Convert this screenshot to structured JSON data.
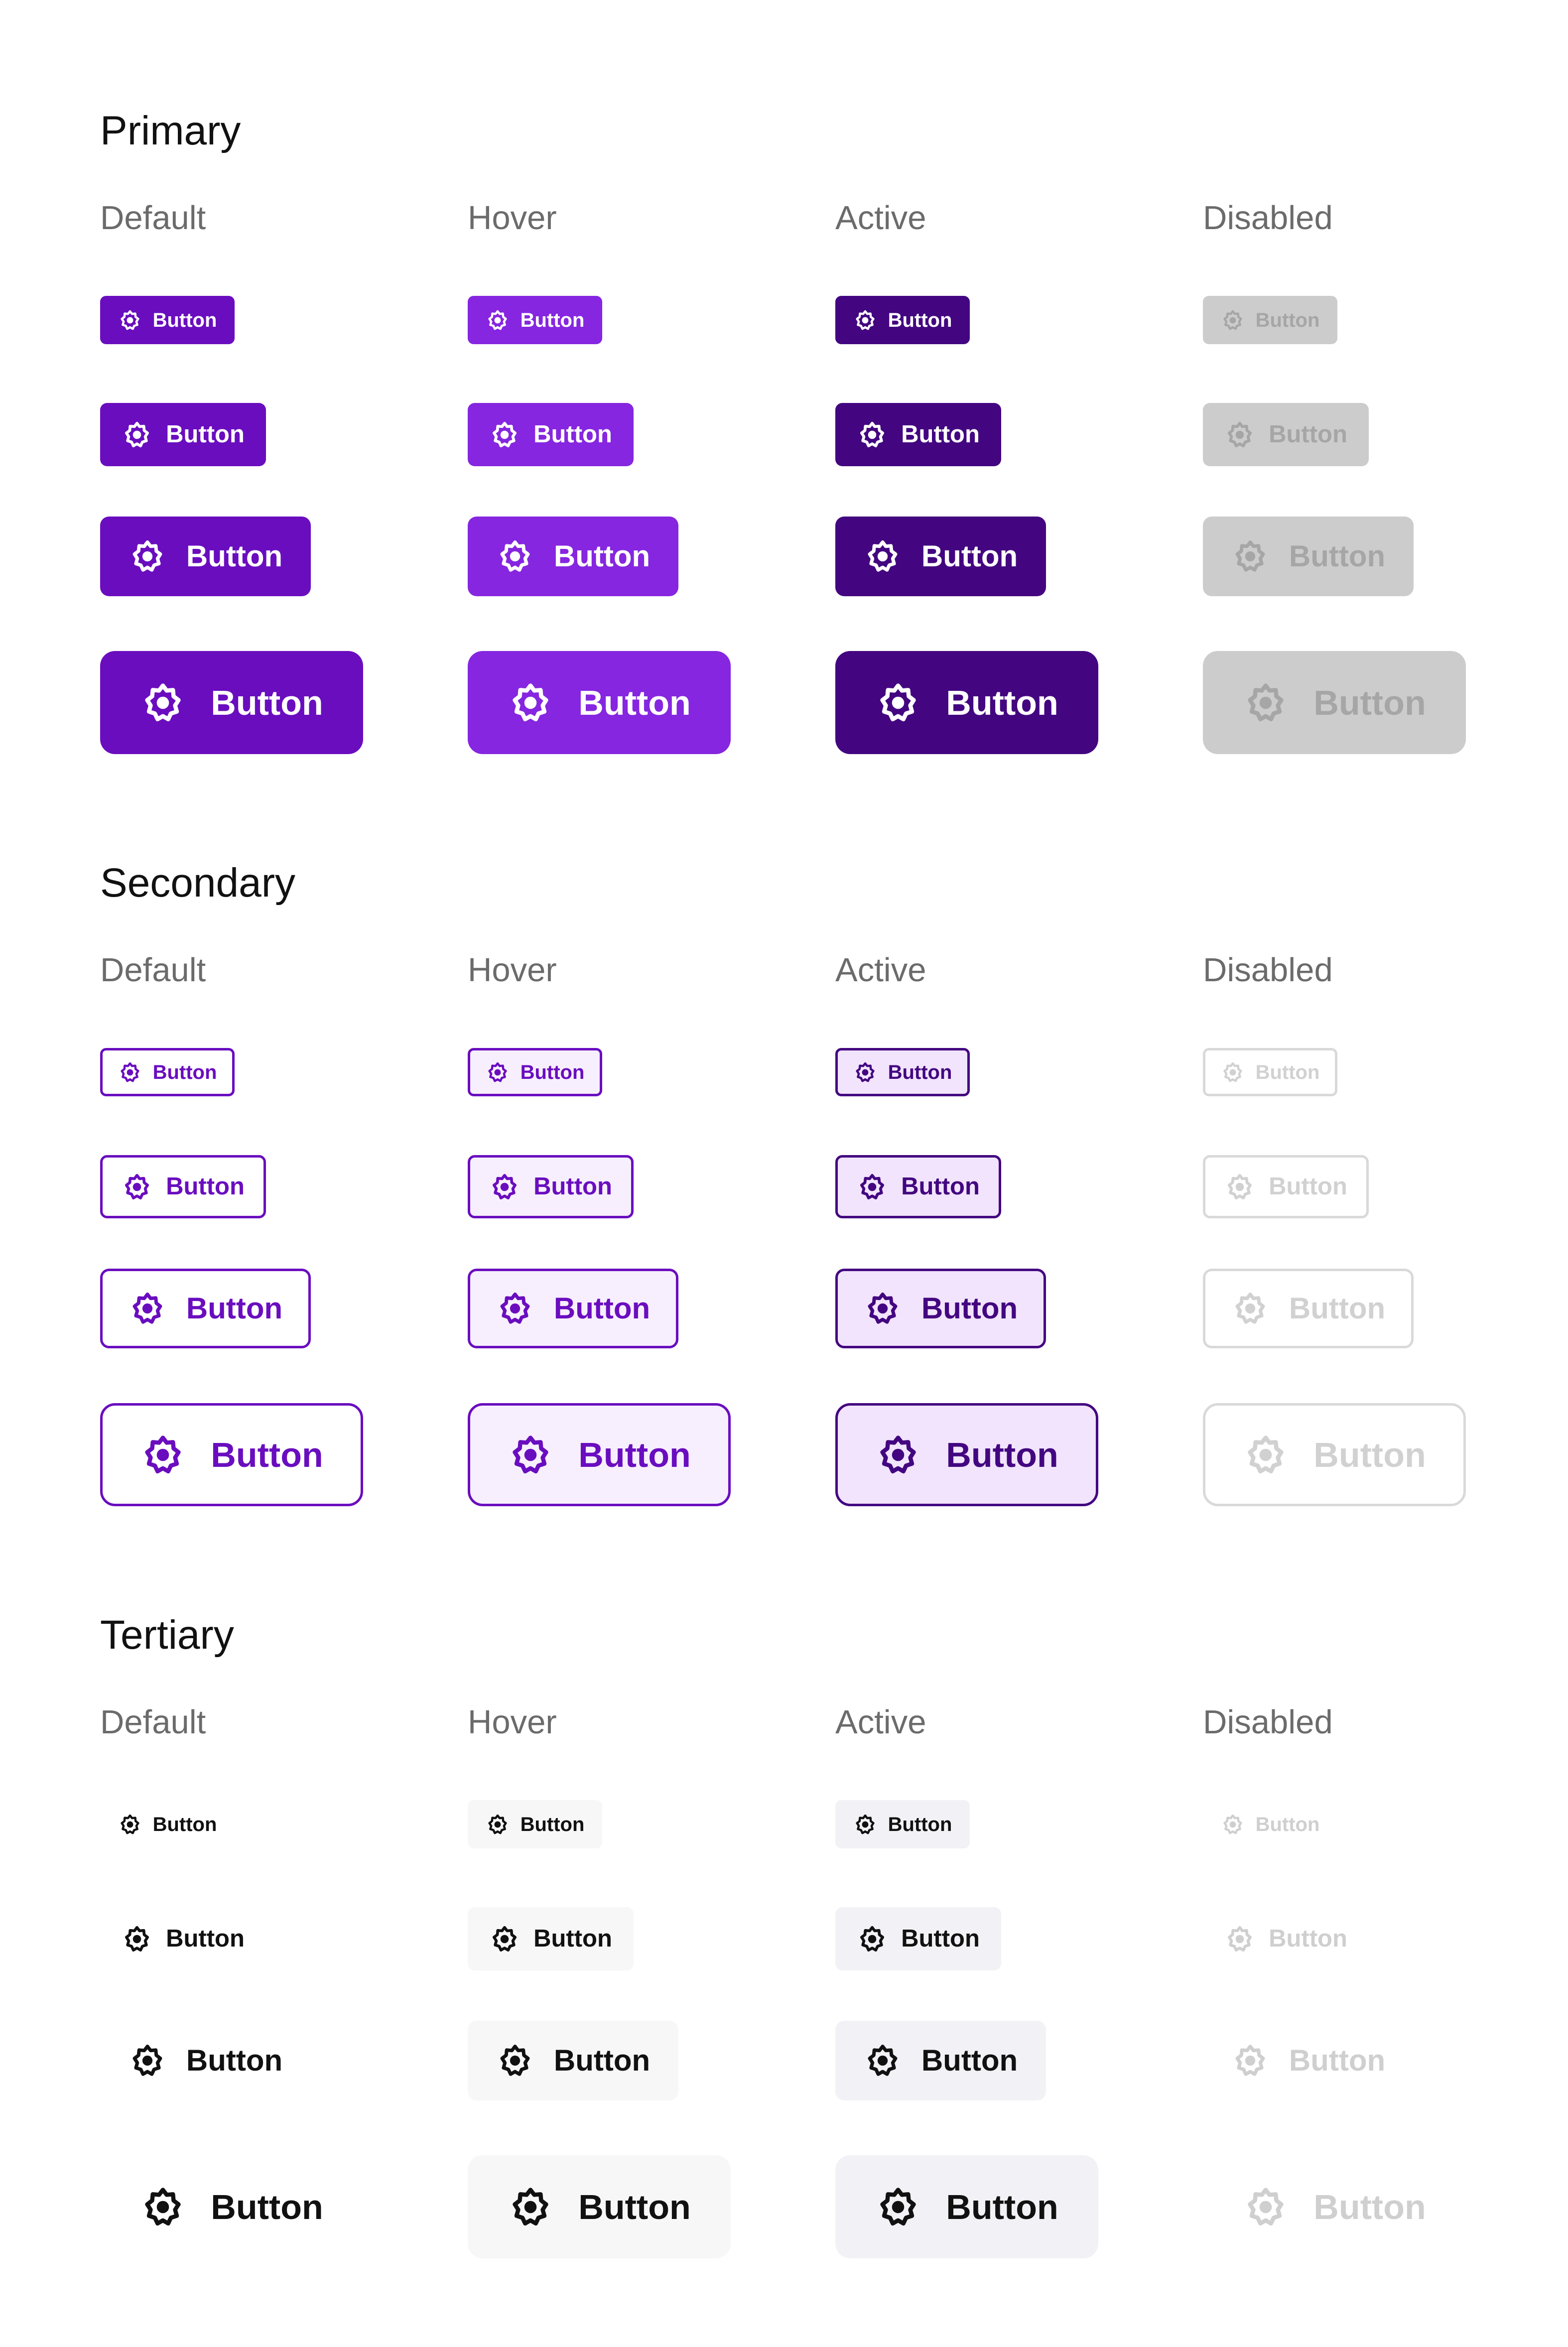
{
  "sections": [
    {
      "title": "Primary",
      "states": [
        "Default",
        "Hover",
        "Active",
        "Disabled"
      ],
      "button_label": "Button",
      "icon": "gear-icon"
    },
    {
      "title": "Secondary",
      "states": [
        "Default",
        "Hover",
        "Active",
        "Disabled"
      ],
      "button_label": "Button",
      "icon": "gear-icon"
    },
    {
      "title": "Tertiary",
      "states": [
        "Default",
        "Hover",
        "Active",
        "Disabled"
      ],
      "button_label": "Button",
      "icon": "gear-icon"
    }
  ],
  "colors": {
    "primary_default": "#6a0dbf",
    "primary_hover": "#8626e0",
    "primary_active": "#430680",
    "primary_disabled_bg": "#cccccc",
    "primary_disabled_fg": "#a6a6a6",
    "secondary_border": "#6a0dbf",
    "secondary_hover_bg": "#f7effd",
    "secondary_active_bg": "#f1e4fc",
    "secondary_active_border": "#430680",
    "secondary_disabled_border": "#d9d9d9",
    "secondary_disabled_fg": "#d1d1d1",
    "tertiary_fg": "#111111",
    "tertiary_hover_bg": "#f7f7f8",
    "tertiary_active_bg": "#f2f1f5",
    "tertiary_disabled_fg": "#cfcfcf",
    "state_label": "#6b6b6b",
    "section_title": "#111111"
  }
}
